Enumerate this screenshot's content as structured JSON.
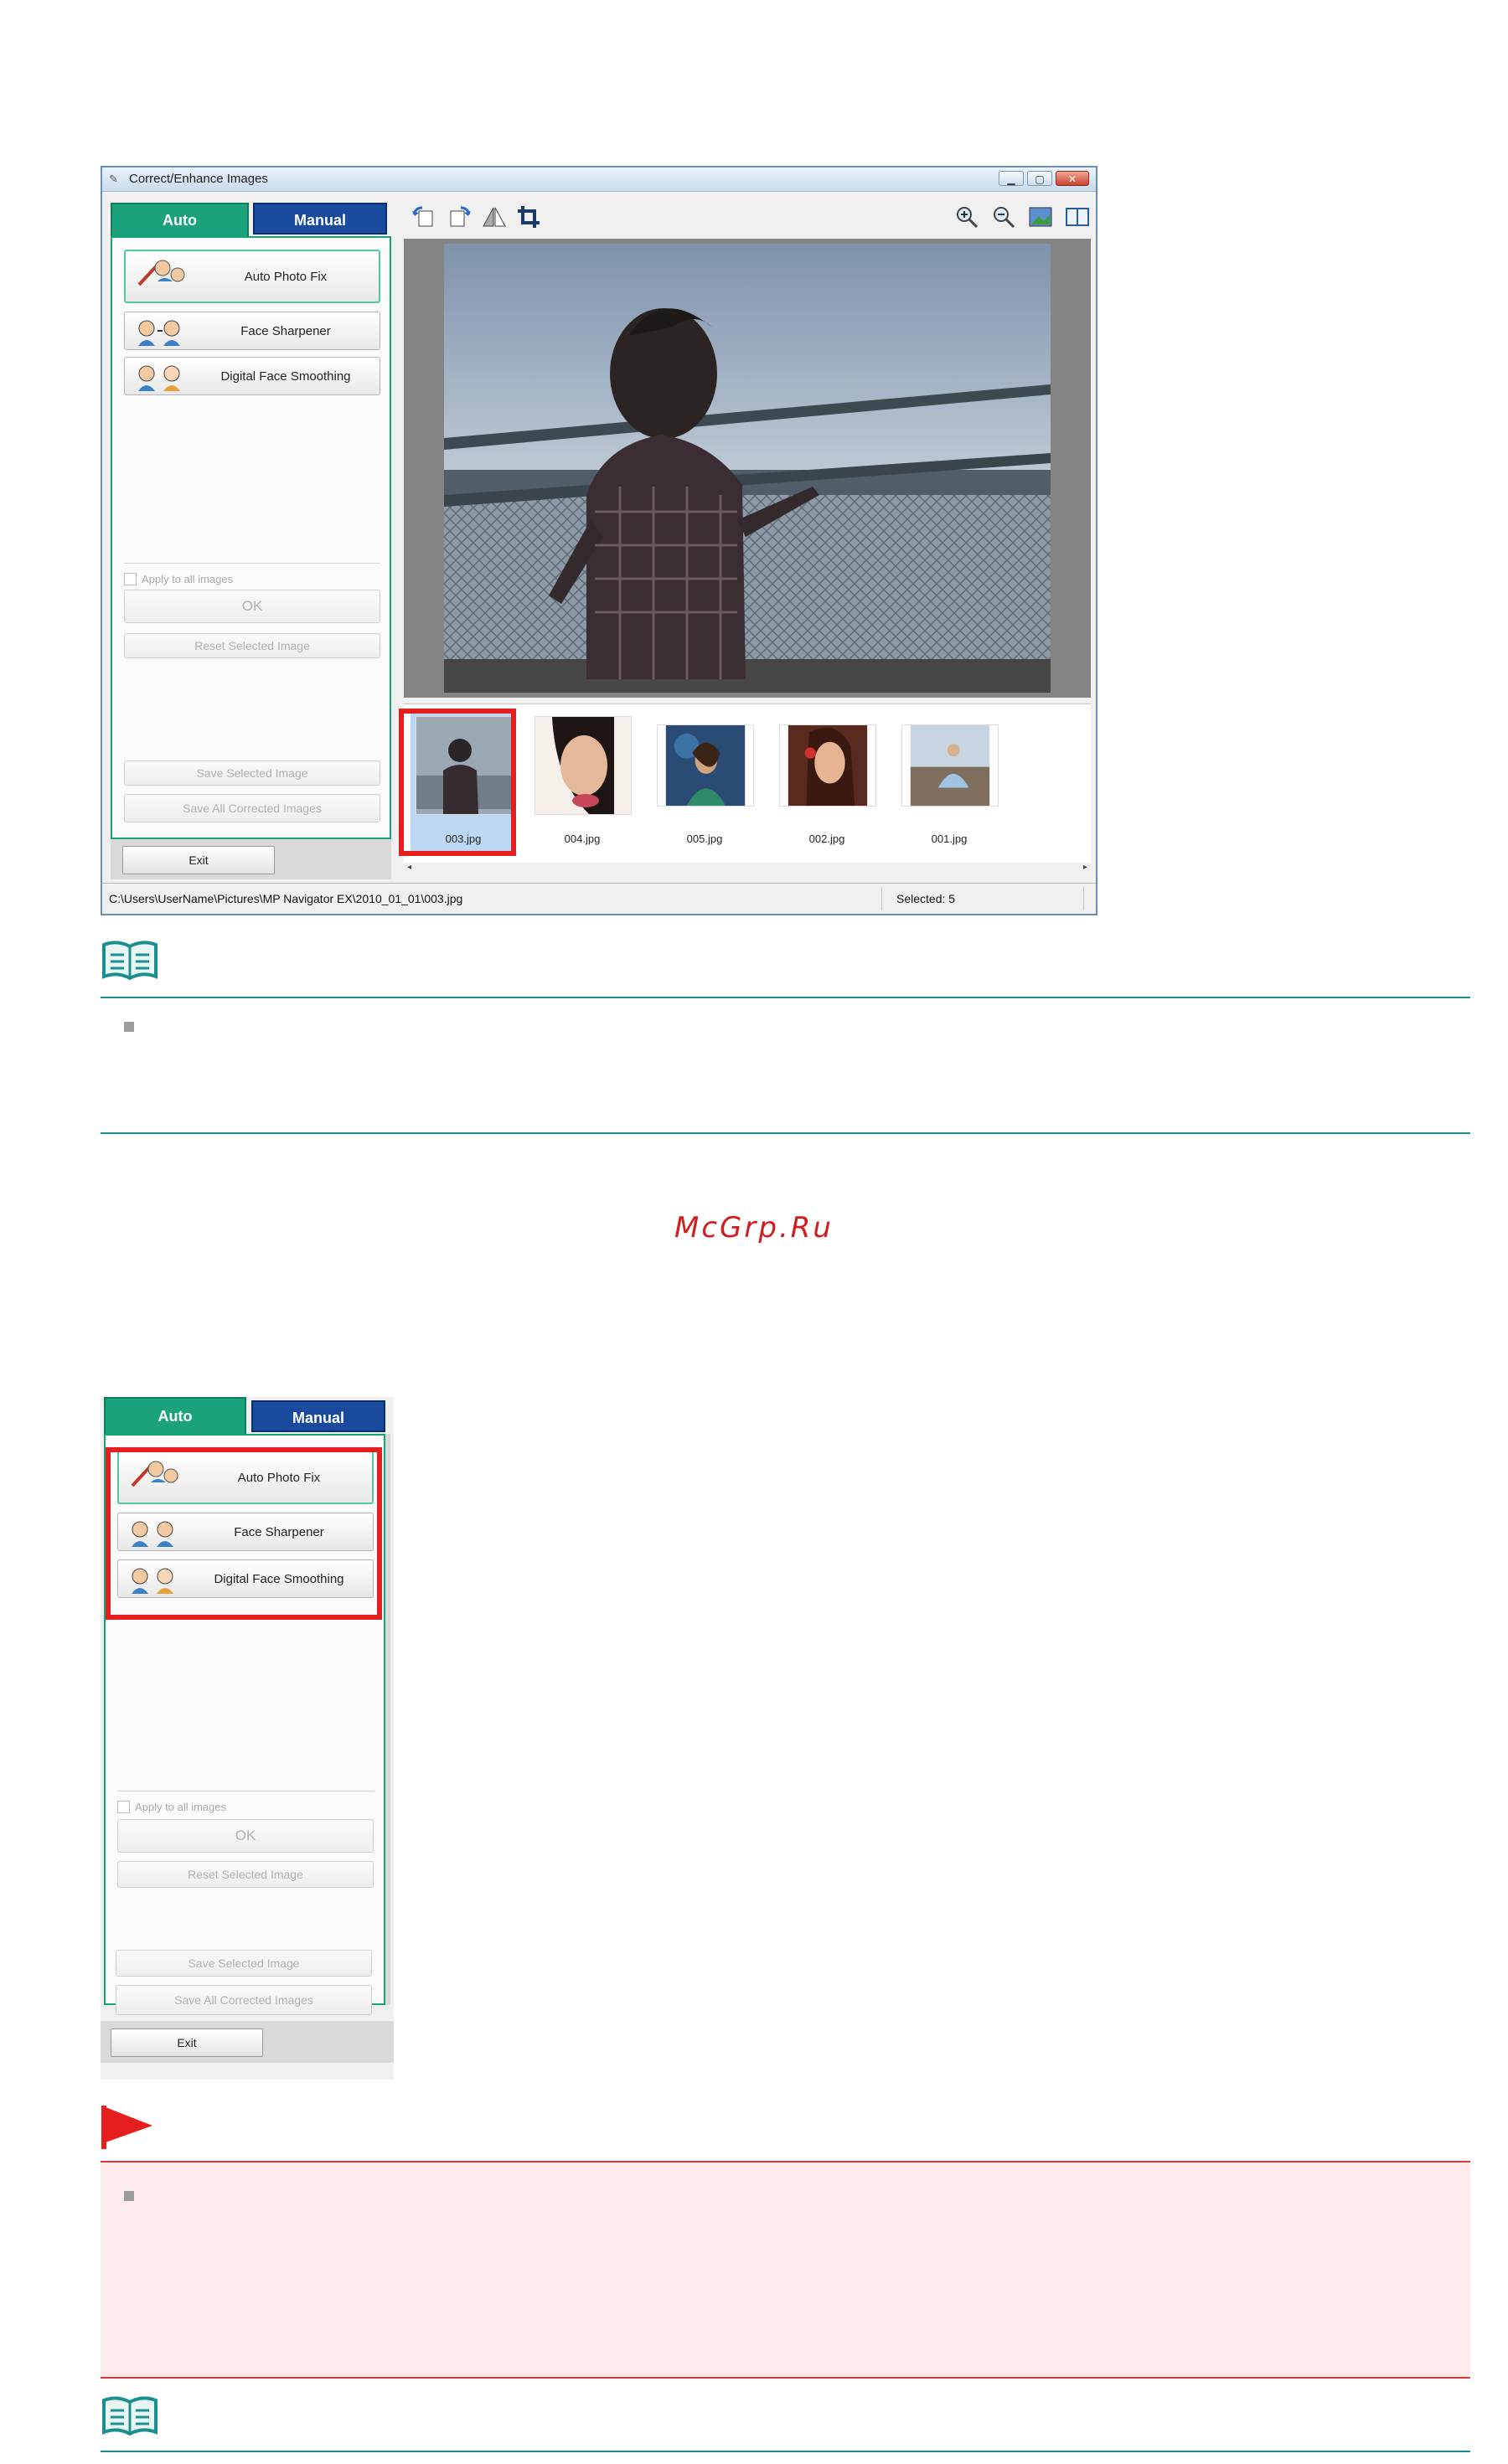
{
  "window": {
    "title": "Correct/Enhance Images",
    "tabs": {
      "auto": "Auto",
      "manual": "Manual"
    },
    "correction_buttons": [
      {
        "label": "Auto Photo Fix",
        "icon": "auto-photo-fix-icon"
      },
      {
        "label": "Face Sharpener",
        "icon": "face-sharpener-icon"
      },
      {
        "label": "Digital Face Smoothing",
        "icon": "digital-face-smoothing-icon"
      }
    ],
    "apply_all_label": "Apply to all images",
    "ok_label": "OK",
    "reset_label": "Reset Selected Image",
    "save_selected_label": "Save Selected Image",
    "save_all_label": "Save All Corrected Images",
    "exit_label": "Exit",
    "toolbar_left": [
      "rotate-left-icon",
      "rotate-right-icon",
      "mirror-icon",
      "crop-icon"
    ],
    "toolbar_right": [
      "zoom-in-icon",
      "zoom-out-icon",
      "full-screen-icon",
      "compare-icon"
    ],
    "thumbnails": [
      {
        "caption": "003.jpg",
        "selected": true
      },
      {
        "caption": "004.jpg",
        "selected": false
      },
      {
        "caption": "005.jpg",
        "selected": false
      },
      {
        "caption": "002.jpg",
        "selected": false
      },
      {
        "caption": "001.jpg",
        "selected": false
      }
    ],
    "status_path": "C:\\Users\\UserName\\Pictures\\MP Navigator EX\\2010_01_01\\003.jpg",
    "status_selected": "Selected: 5",
    "colors": {
      "auto_tab": "#1aa27a",
      "manual_tab": "#1a4a9e",
      "highlight": "#e51e1e"
    }
  },
  "watermark": "McGrp.Ru"
}
